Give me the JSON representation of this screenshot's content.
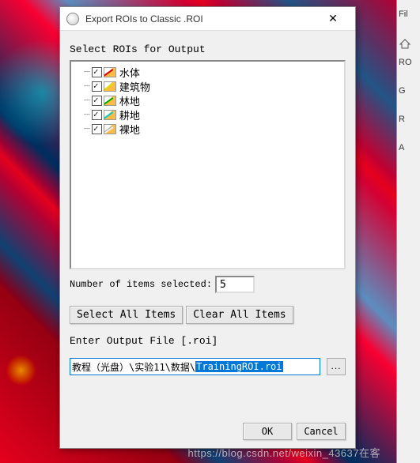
{
  "dialog": {
    "title": "Export ROIs to Classic .ROI",
    "select_label": "Select ROIs for Output",
    "items": [
      {
        "label": "水体",
        "color": "red",
        "checked": true
      },
      {
        "label": "建筑物",
        "color": "yellow",
        "checked": true
      },
      {
        "label": "林地",
        "color": "green",
        "checked": true
      },
      {
        "label": "耕地",
        "color": "cyan",
        "checked": true
      },
      {
        "label": "裸地",
        "color": "white",
        "checked": true
      }
    ],
    "num_label": "Number of items selected:",
    "num_value": "5",
    "select_all": "Select All Items",
    "clear_all": "Clear All Items",
    "output_label": "Enter Output File [.roi]",
    "output_prefix": "教程（光盘）\\实验11\\数据\\",
    "output_selected": "TrainingROI.roi",
    "browse": "...",
    "ok": "OK",
    "cancel": "Cancel"
  },
  "right": {
    "fil": "Fil",
    "ro": "RO",
    "g": "G",
    "r": "R",
    "a": "A"
  },
  "watermark": "https://blog.csdn.net/weixin_43637在客"
}
